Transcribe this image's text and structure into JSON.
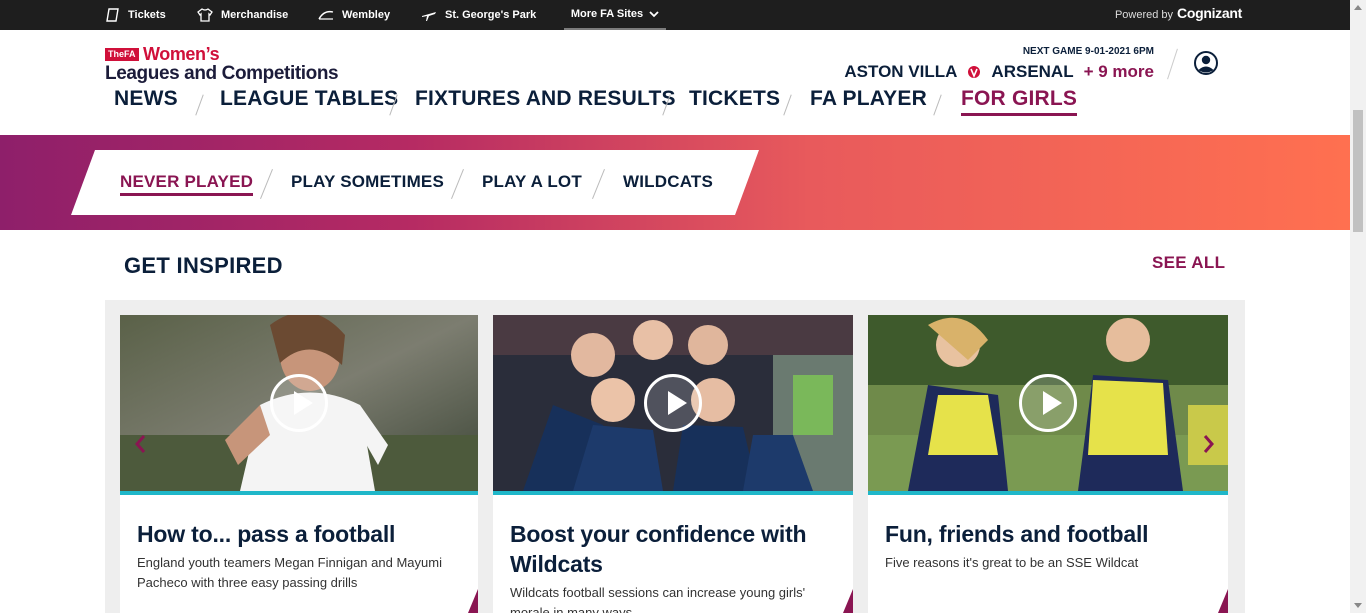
{
  "topbar": {
    "links": [
      {
        "label": "Tickets",
        "icon": "ticket-icon"
      },
      {
        "label": "Merchandise",
        "icon": "shirt-icon"
      },
      {
        "label": "Wembley",
        "icon": "wembley-arch-icon"
      },
      {
        "label": "St. George's Park",
        "icon": "plane-icon"
      }
    ],
    "more_sites": "More FA Sites",
    "powered_by": "Powered by",
    "sponsor": "Cognizant"
  },
  "logo": {
    "badge": "TheFA",
    "line1": "Women’s",
    "line2": "Leagues and Competitions"
  },
  "next_game": {
    "label": "NEXT GAME 9-01-2021 6PM",
    "home": "ASTON VILLA",
    "away": "ARSENAL",
    "more": "+ 9 more"
  },
  "main_nav": [
    "NEWS",
    "LEAGUE TABLES",
    "FIXTURES AND RESULTS",
    "TICKETS",
    "FA PLAYER",
    "FOR GIRLS"
  ],
  "sub_nav": [
    "NEVER PLAYED",
    "PLAY SOMETIMES",
    "PLAY A LOT",
    "WILDCATS"
  ],
  "section": {
    "title": "GET INSPIRED",
    "see_all": "SEE ALL"
  },
  "cards": [
    {
      "title": "How to... pass a football",
      "desc": "England youth teamers Megan Finnigan and Mayumi Pacheco with three easy passing drills"
    },
    {
      "title": "Boost your confidence with Wildcats",
      "desc": "Wildcats football sessions can increase young girls' morale in many ways"
    },
    {
      "title": "Fun, friends and football",
      "desc": "Five reasons it's great to be an SSE Wildcat"
    }
  ],
  "colors": {
    "brand_purple": "#8a1552",
    "navy": "#0b1f3a",
    "teal": "#1fb7c9",
    "fa_red": "#d0103a"
  }
}
